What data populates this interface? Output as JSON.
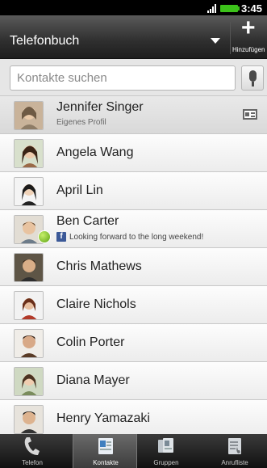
{
  "status_bar": {
    "time": "3:45"
  },
  "header": {
    "title": "Telefonbuch",
    "add_label": "Hinzufügen",
    "add_symbol": "+"
  },
  "search": {
    "placeholder": "Kontakte suchen"
  },
  "contacts": [
    {
      "name": "Jennifer Singer",
      "sub": "Eigenes Profil",
      "my_profile": true
    },
    {
      "name": "Angela Wang"
    },
    {
      "name": "April Lin"
    },
    {
      "name": "Ben Carter",
      "status": "Looking forward to the long weekend!",
      "online": true
    },
    {
      "name": "Chris Mathews"
    },
    {
      "name": "Claire Nichols"
    },
    {
      "name": "Colin Porter"
    },
    {
      "name": "Diana Mayer"
    },
    {
      "name": "Henry Yamazaki"
    }
  ],
  "tabs": [
    {
      "label": "Telefon",
      "icon": "phone-icon"
    },
    {
      "label": "Kontakte",
      "icon": "contacts-icon",
      "active": true
    },
    {
      "label": "Gruppen",
      "icon": "groups-icon"
    },
    {
      "label": "Anrufliste",
      "icon": "call-history-icon"
    }
  ],
  "colors": {
    "battery": "#3cc21a",
    "facebook": "#3b5998",
    "online": "#5ba212"
  }
}
